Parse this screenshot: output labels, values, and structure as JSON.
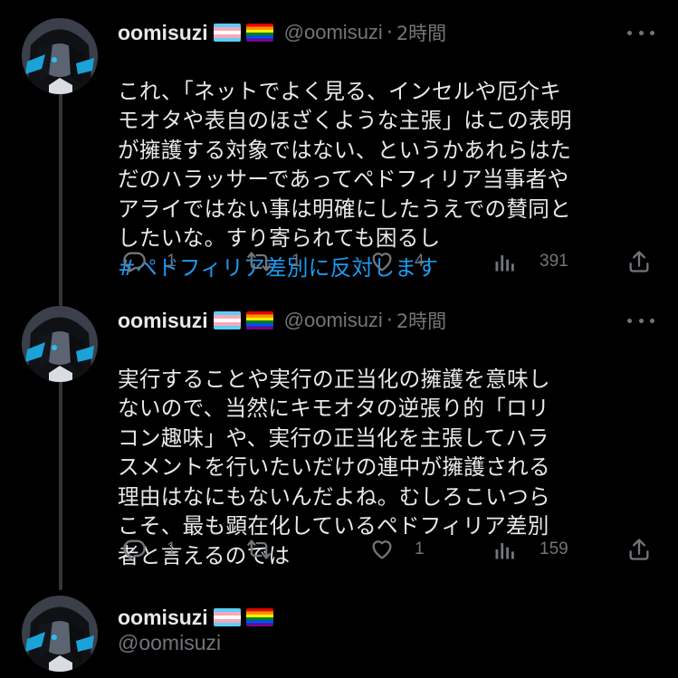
{
  "tweets": [
    {
      "name": "oomisuzi",
      "handle": "@oomisuzi",
      "separator": "·",
      "time": "2時間",
      "text": "これ、「ネットでよく見る、インセルや厄介キ\nモオタや表自のほざくような主張」はこの表明\nが擁護する対象ではない、というかあれらはた\nだのハラッサーであってペドフィリア当事者や\nアライではない事は明確にしたうえでの賛同と\nしたいな。すり寄られても困るし",
      "hashtag": "#ペドフィリア差別に反対します",
      "replies": "1",
      "retweets": "1",
      "likes": "4",
      "views": "391"
    },
    {
      "name": "oomisuzi",
      "handle": "@oomisuzi",
      "separator": "·",
      "time": "2時間",
      "text": "実行することや実行の正当化の擁護を意味し\nないので、当然にキモオタの逆張り的「ロリ\nコン趣味」や、実行の正当化を主張してハラ\nスメントを行いたいだけの連中が擁護される\n理由はなにもないんだよね。むしろこいつら\nこそ、最も顕在化しているペドフィリア差別\n者と言えるのでは",
      "replies": "1",
      "retweets": "",
      "likes": "1",
      "views": "159"
    }
  ],
  "profile": {
    "name": "oomisuzi",
    "handle": "@oomisuzi"
  },
  "icons": {
    "reply": "reply-icon",
    "retweet": "retweet-icon",
    "like": "heart-icon",
    "views": "views-chart-icon",
    "share": "share-icon",
    "more": "more-icon",
    "flag_trans": "transgender-flag-icon",
    "flag_rainbow": "rainbow-flag-icon"
  },
  "colors": {
    "background": "#000000",
    "text": "#e7e9ea",
    "secondary": "#71767b",
    "link": "#1d9bf0",
    "thread_line": "#333639"
  }
}
